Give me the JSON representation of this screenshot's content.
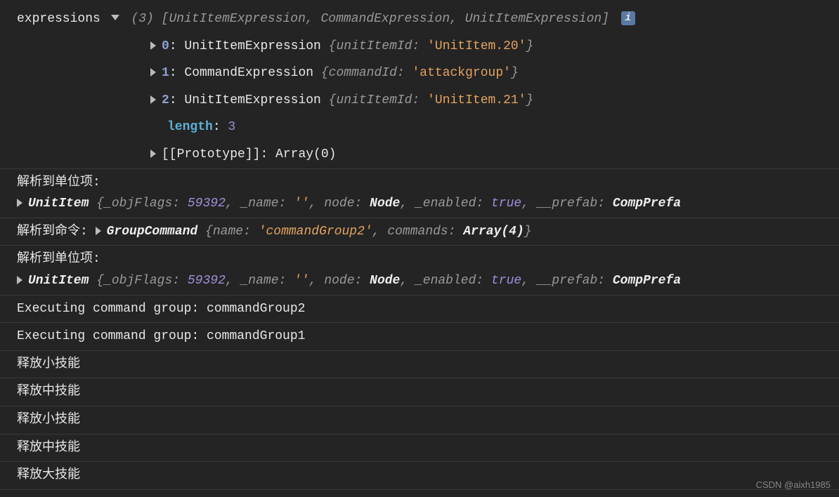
{
  "header": {
    "label": "expressions",
    "summary_count": "(3)",
    "summary_types": "[UnitItemExpression, CommandExpression, UnitItemExpression]",
    "info_badge": "i"
  },
  "array": [
    {
      "index": "0",
      "colon": ": ",
      "type": "UnitItemExpression ",
      "brace_open": "{",
      "prop_key": "unitItemId: ",
      "prop_val": "'UnitItem.20'",
      "brace_close": "}"
    },
    {
      "index": "1",
      "colon": ": ",
      "type": "CommandExpression ",
      "brace_open": "{",
      "prop_key": "commandId: ",
      "prop_val": "'attackgroup'",
      "brace_close": "}"
    },
    {
      "index": "2",
      "colon": ": ",
      "type": "UnitItemExpression ",
      "brace_open": "{",
      "prop_key": "unitItemId: ",
      "prop_val": "'UnitItem.21'",
      "brace_close": "}"
    }
  ],
  "length": {
    "key": "length",
    "colon": ": ",
    "val": "3"
  },
  "proto": {
    "key": "[[Prototype]]",
    "colon": ": ",
    "val": "Array(0)"
  },
  "unit_item_1": {
    "label": "解析到单位项:",
    "obj_name": "UnitItem ",
    "brace_open": "{",
    "k1": "_objFlags: ",
    "v1": "59392",
    "sep1": ", ",
    "k2": "_name: ",
    "v2": "''",
    "sep2": ", ",
    "k3": "node: ",
    "v3": "Node",
    "sep3": ", ",
    "k4": "_enabled: ",
    "v4": "true",
    "sep4": ", ",
    "k5": "__prefab: ",
    "v5": "CompPrefa"
  },
  "command": {
    "label": "解析到命令:   ",
    "obj_name": "GroupCommand ",
    "brace_open": "{",
    "k1": "name: ",
    "v1": "'commandGroup2'",
    "sep1": ", ",
    "k2": "commands: ",
    "v2": "Array(4)",
    "brace_close": "}"
  },
  "unit_item_2": {
    "label": "解析到单位项:",
    "obj_name": "UnitItem ",
    "brace_open": "{",
    "k1": "_objFlags: ",
    "v1": "59392",
    "sep1": ", ",
    "k2": "_name: ",
    "v2": "''",
    "sep2": ", ",
    "k3": "node: ",
    "v3": "Node",
    "sep3": ", ",
    "k4": "_enabled: ",
    "v4": "true",
    "sep4": ", ",
    "k5": "__prefab: ",
    "v5": "CompPrefa"
  },
  "exec1": "Executing command group: commandGroup2",
  "exec2": "Executing command group: commandGroup1",
  "skill1": "释放小技能",
  "skill2": "释放中技能",
  "skill3": "释放小技能",
  "skill4": "释放中技能",
  "skill5": "释放大技能",
  "watermark": "CSDN @aixh1985"
}
